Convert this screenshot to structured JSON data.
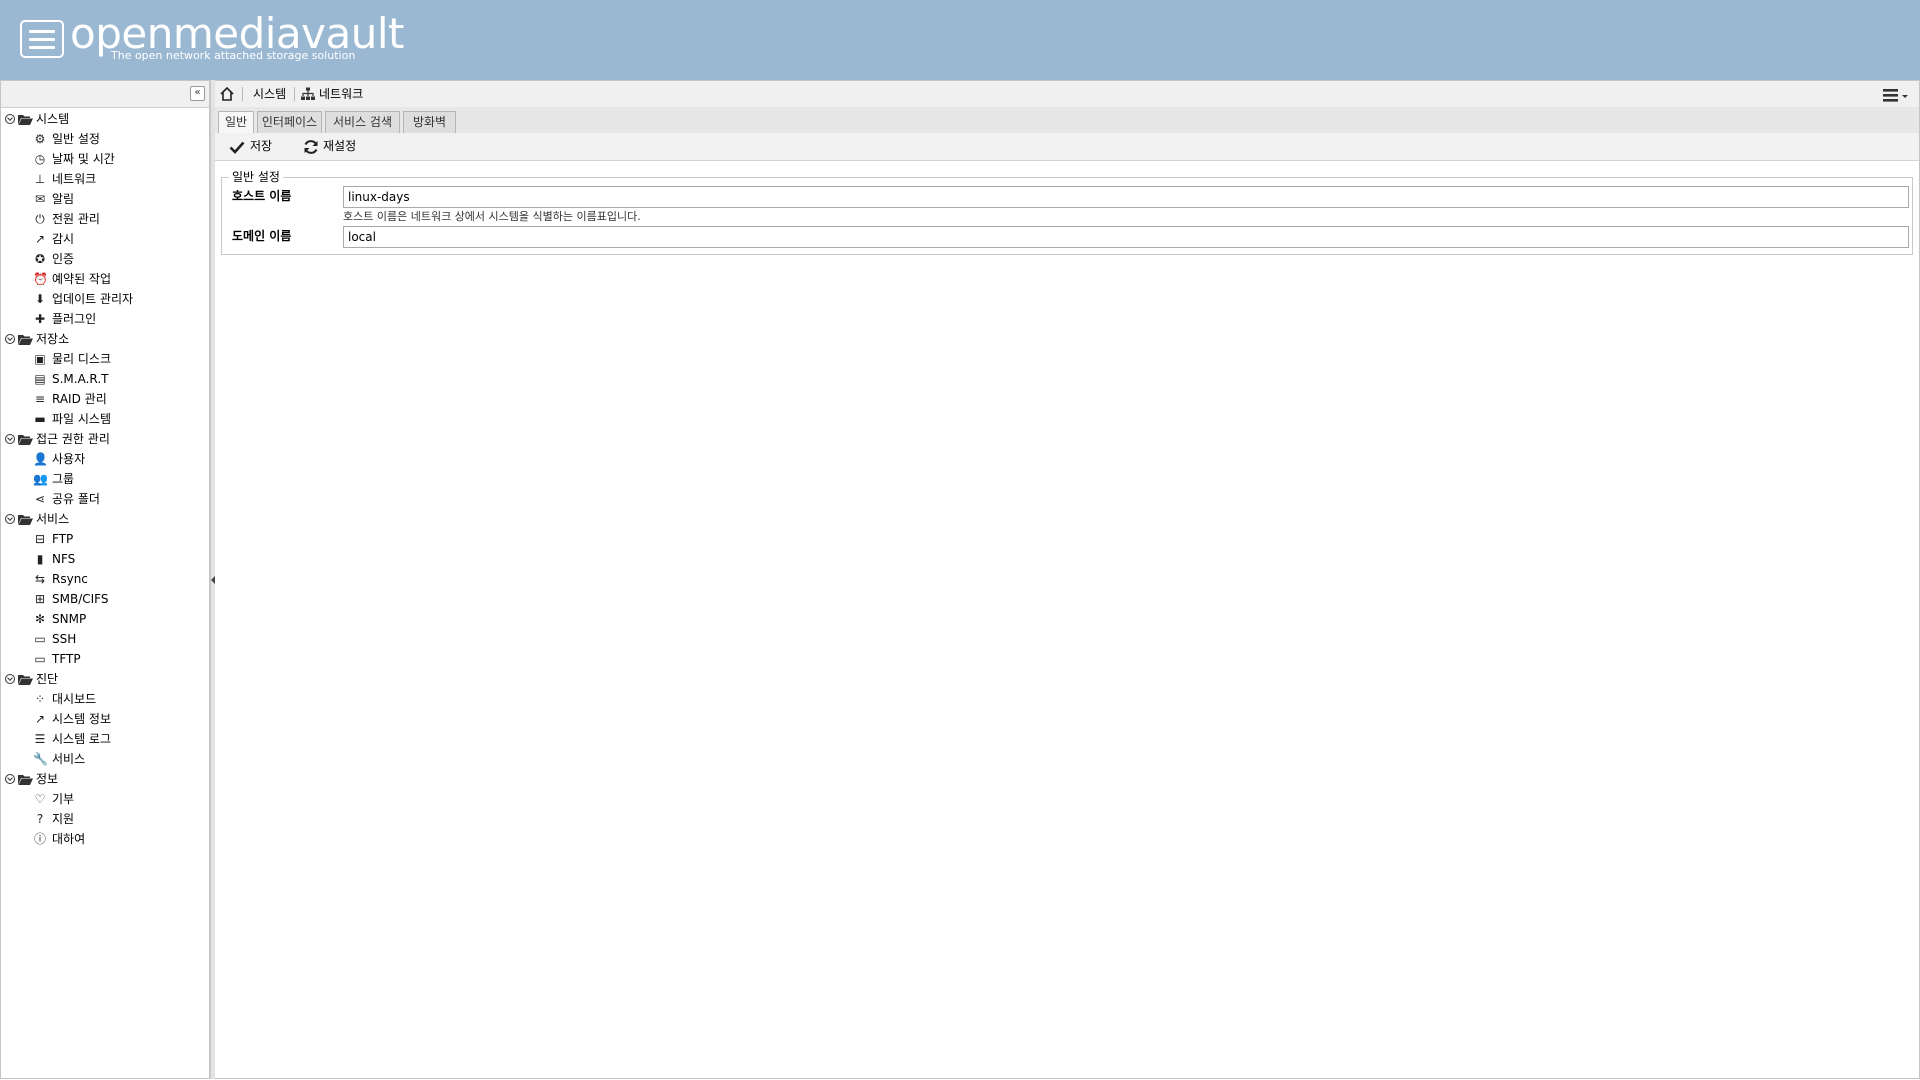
{
  "header": {
    "logo_name": "openmediavault",
    "logo_tagline": "The open network attached storage solution"
  },
  "sidebar": {
    "categories": [
      {
        "label": "시스템",
        "items": [
          {
            "label": "일반 설정",
            "icon": "gears-icon"
          },
          {
            "label": "날짜 및 시간",
            "icon": "clock-icon"
          },
          {
            "label": "네트워크",
            "icon": "sitemap-icon"
          },
          {
            "label": "알림",
            "icon": "envelope-icon"
          },
          {
            "label": "전원 관리",
            "icon": "power-icon"
          },
          {
            "label": "감시",
            "icon": "line-chart-icon"
          },
          {
            "label": "인증",
            "icon": "certificate-icon"
          },
          {
            "label": "예약된 작업",
            "icon": "alarm-clock-icon"
          },
          {
            "label": "업데이트 관리자",
            "icon": "download-icon"
          },
          {
            "label": "플러그인",
            "icon": "puzzle-icon"
          }
        ]
      },
      {
        "label": "저장소",
        "items": [
          {
            "label": "물리 디스크",
            "icon": "hdd-icon"
          },
          {
            "label": "S.M.A.R.T",
            "icon": "smart-icon"
          },
          {
            "label": "RAID 관리",
            "icon": "database-icon"
          },
          {
            "label": "파일 시스템",
            "icon": "folder-icon"
          }
        ]
      },
      {
        "label": "접근 권한 관리",
        "items": [
          {
            "label": "사용자",
            "icon": "user-icon"
          },
          {
            "label": "그룹",
            "icon": "users-icon"
          },
          {
            "label": "공유 폴더",
            "icon": "share-icon"
          }
        ]
      },
      {
        "label": "서비스",
        "items": [
          {
            "label": "FTP",
            "icon": "ftp-icon"
          },
          {
            "label": "NFS",
            "icon": "nfs-icon"
          },
          {
            "label": "Rsync",
            "icon": "rsync-icon"
          },
          {
            "label": "SMB/CIFS",
            "icon": "windows-icon"
          },
          {
            "label": "SNMP",
            "icon": "snmp-icon"
          },
          {
            "label": "SSH",
            "icon": "terminal-icon"
          },
          {
            "label": "TFTP",
            "icon": "tftp-icon"
          }
        ]
      },
      {
        "label": "진단",
        "items": [
          {
            "label": "대시보드",
            "icon": "dashboard-icon"
          },
          {
            "label": "시스템 정보",
            "icon": "line-chart-icon"
          },
          {
            "label": "시스템 로그",
            "icon": "log-icon"
          },
          {
            "label": "서비스",
            "icon": "wrench-icon"
          }
        ]
      },
      {
        "label": "정보",
        "items": [
          {
            "label": "기부",
            "icon": "heart-icon"
          },
          {
            "label": "지원",
            "icon": "question-icon"
          },
          {
            "label": "대하여",
            "icon": "info-icon"
          }
        ]
      }
    ]
  },
  "breadcrumb": {
    "items": [
      "시스템",
      "네트워크"
    ]
  },
  "tabs": [
    "일반",
    "인터페이스",
    "서비스 검색",
    "방화벽"
  ],
  "toolbar": {
    "save_label": "저장",
    "reset_label": "재설정"
  },
  "form": {
    "legend": "일반 설정",
    "hostname_label": "호스트 이름",
    "hostname_value": "linux-days",
    "hostname_help": "호스트 이름은 네트워크 상에서 시스템을 식별하는 이름표입니다.",
    "domain_label": "도메인 이름",
    "domain_value": "local"
  }
}
